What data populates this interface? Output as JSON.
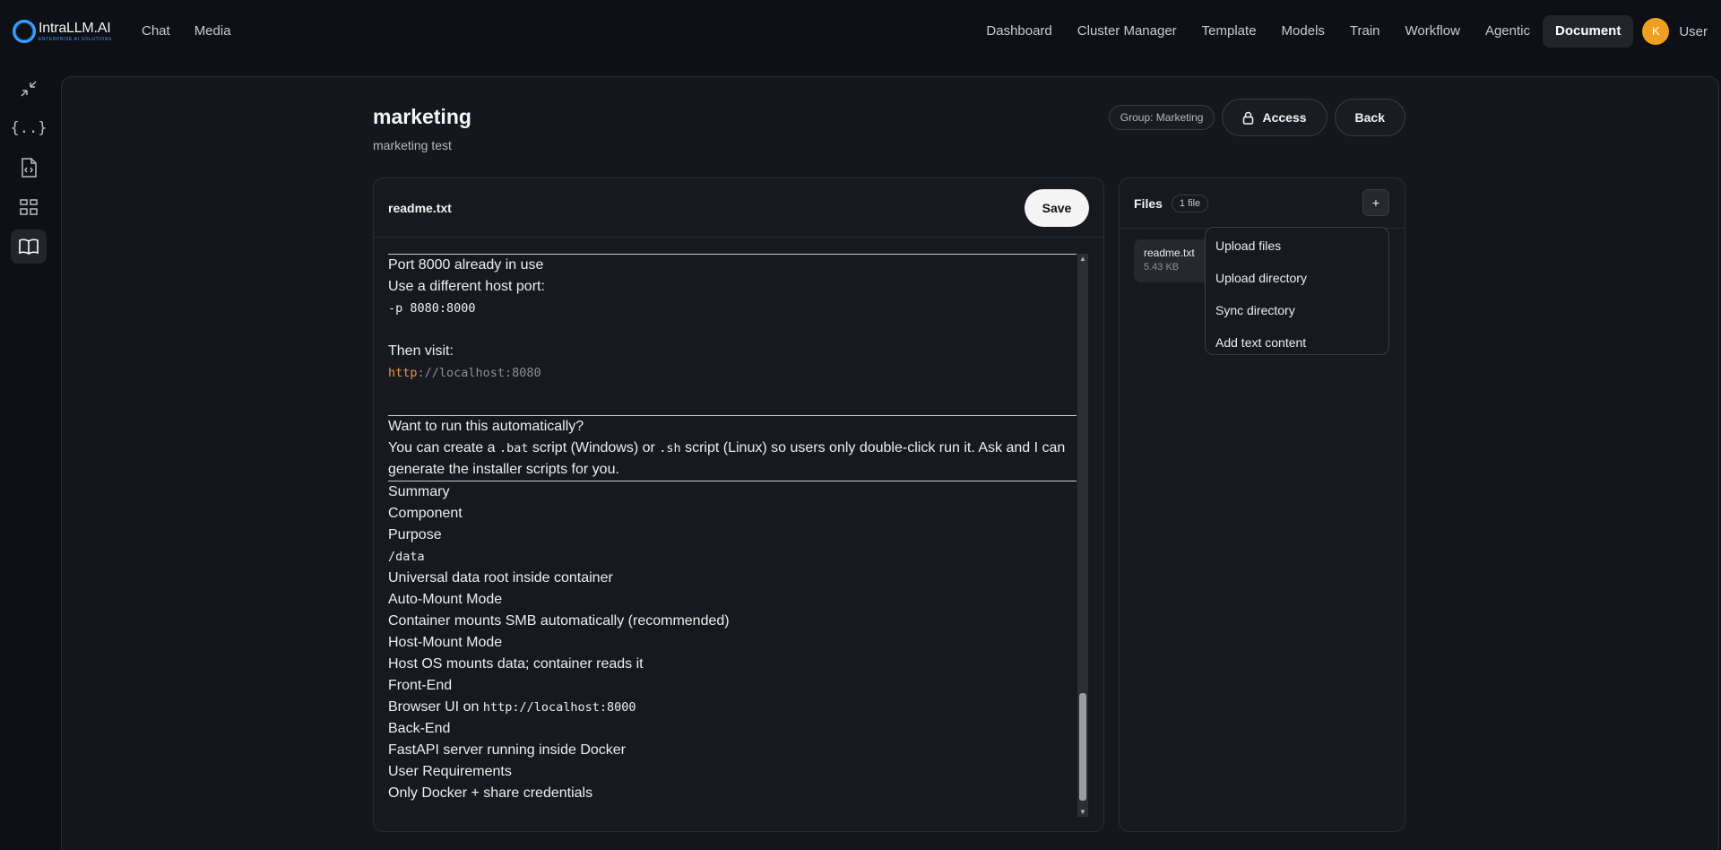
{
  "brand": {
    "name": "IntraLLM.AI",
    "tagline": "ENTERPRISE AI SOLUTIONS"
  },
  "nav_left": [
    {
      "label": "Chat"
    },
    {
      "label": "Media"
    }
  ],
  "nav_right": [
    {
      "label": "Dashboard"
    },
    {
      "label": "Cluster Manager"
    },
    {
      "label": "Template"
    },
    {
      "label": "Models"
    },
    {
      "label": "Train"
    },
    {
      "label": "Workflow"
    },
    {
      "label": "Agentic"
    },
    {
      "label": "Document",
      "active": true
    }
  ],
  "user": {
    "initial": "K",
    "name": "User"
  },
  "siderail": [
    "collapse-icon",
    "braces-icon",
    "code-file-icon",
    "grid-icon",
    "book-icon"
  ],
  "document": {
    "title": "marketing",
    "subtitle": "marketing test",
    "group_badge": "Group: Marketing",
    "access_label": "Access",
    "back_label": "Back"
  },
  "editor": {
    "file_name": "readme.txt",
    "save_label": "Save",
    "content": {
      "l1": "Port 8000 already in use",
      "l2": "Use a different host port:",
      "l3": "-p 8080:8000",
      "l5": "Then visit:",
      "l6_http": "http",
      "l6_rest": "://localhost:8080",
      "l8": "Want to run this automatically?",
      "l9_a": "You can create a ",
      "l9_b": ".bat",
      "l9_c": " script (Windows) or ",
      "l9_d": ".sh",
      "l9_e": " script (Linux) so users only double-click run it. Ask and I can",
      "l10": "generate the installer scripts for you.",
      "summary": [
        "Summary",
        "Component",
        "Purpose"
      ],
      "data_path": "/data",
      "rows": [
        "Universal data root inside container",
        "Auto-Mount Mode",
        "Container mounts SMB automatically (recommended)",
        "Host-Mount Mode",
        "Host OS mounts data; container reads it",
        "Front-End"
      ],
      "browser_ui_a": "Browser UI on ",
      "browser_ui_b": "http://localhost:8000",
      "rows2": [
        "Back-End",
        "FastAPI server running inside Docker",
        "User Requirements",
        "Only Docker + share credentials"
      ]
    }
  },
  "files": {
    "title": "Files",
    "count": "1 file",
    "add_label": "+",
    "item": {
      "name": "readme.txt",
      "size": "5.43 KB"
    }
  },
  "dropdown": [
    {
      "label": "Upload files"
    },
    {
      "label": "Upload directory"
    },
    {
      "label": "Sync directory"
    },
    {
      "label": "Add text content"
    }
  ]
}
